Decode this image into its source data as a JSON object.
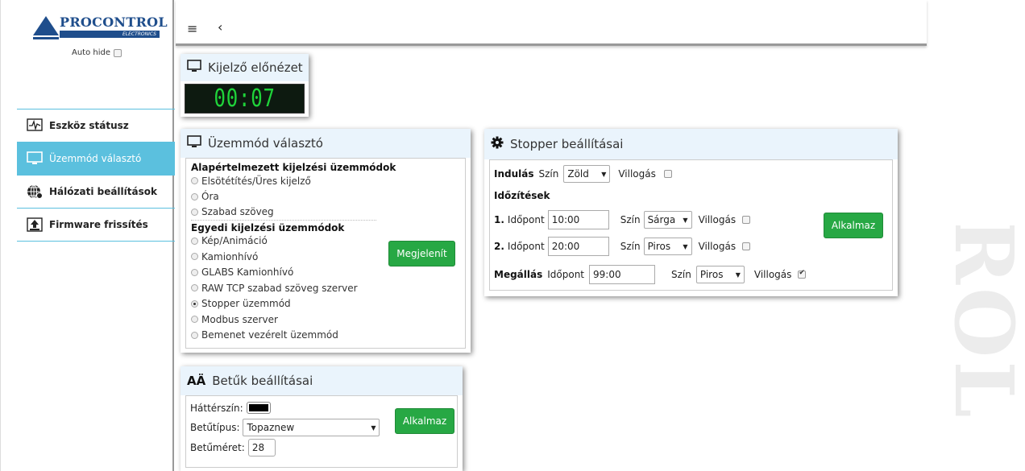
{
  "logo": {
    "brand": "PROCONTROL",
    "sub": "ELECTRONICS"
  },
  "sidebar": {
    "autohide_label": "Auto hide",
    "items": [
      {
        "label": "Eszköz státusz",
        "icon": "pulse-icon"
      },
      {
        "label": "Üzemmód választó",
        "icon": "monitor-icon",
        "active": true
      },
      {
        "label": "Hálózati beállítások",
        "icon": "globe-icon"
      },
      {
        "label": "Firmware frissítés",
        "icon": "upload-icon"
      }
    ]
  },
  "topbar": {
    "menu_icon": "≡",
    "back_icon": "‹"
  },
  "preview": {
    "title": "Kijelző előnézet",
    "display_value": "00:07"
  },
  "mode": {
    "title": "Üzemmód választó",
    "default_header": "Alapértelmezett kijelzési üzemmódok",
    "default_options": [
      "Elsötétítés/Üres kijelző",
      "Óra",
      "Szabad szöveg"
    ],
    "custom_header": "Egyedi kijelzési üzemmódok",
    "custom_options": [
      "Kép/Animáció",
      "Kamionhívó",
      "GLABS Kamionhívó",
      "RAW TCP szabad szöveg szerver",
      "Stopper üzemmód",
      "Modbus szerver",
      "Bemenet vezérelt üzemmód"
    ],
    "selected": "Stopper üzemmód",
    "show_button": "Megjelenít"
  },
  "fonts": {
    "title": "Betűk beállításai",
    "bg_label": "Háttérszín:",
    "bg_color": "#000000",
    "font_label": "Betűtípus:",
    "font_value": "Topaznew",
    "size_label": "Betűméret:",
    "size_value": "28",
    "apply_button": "Alkalmaz"
  },
  "stopper": {
    "title": "Stopper beállításai",
    "start_label": "Indulás",
    "color_label": "Szín",
    "start_color": "Zöld",
    "blink_label": "Villogás",
    "timings_header": "Időzítések",
    "timing1_num": "1.",
    "timing2_num": "2.",
    "time_label": "Időpont",
    "timing1_time": "10:00",
    "timing1_color": "Sárga",
    "timing2_time": "20:00",
    "timing2_color": "Piros",
    "stop_label": "Megállás",
    "stop_time": "99:00",
    "stop_color": "Piros",
    "stop_blink": true,
    "apply_button": "Alkalmaz"
  },
  "colors": {
    "accent": "#5bc0de",
    "green": "#27a844",
    "display_green": "#1fd43a",
    "brand": "#1f4e8c"
  }
}
